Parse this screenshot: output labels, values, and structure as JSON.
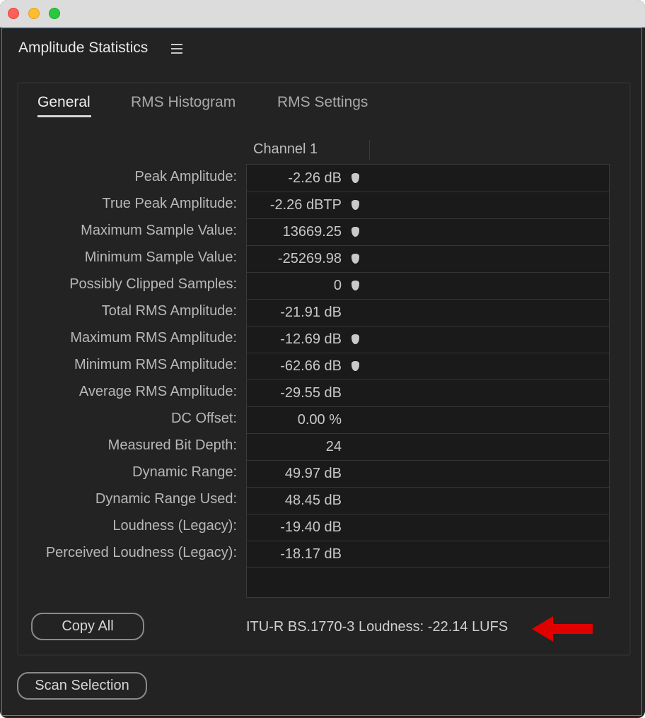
{
  "window": {
    "panel_title": "Amplitude Statistics"
  },
  "tabs": [
    {
      "label": "General",
      "active": true
    },
    {
      "label": "RMS Histogram",
      "active": false
    },
    {
      "label": "RMS Settings",
      "active": false
    }
  ],
  "table": {
    "column_header": "Channel 1",
    "rows": [
      {
        "label": "Peak Amplitude:",
        "value": "-2.26 dB",
        "marker": true
      },
      {
        "label": "True Peak Amplitude:",
        "value": "-2.26 dBTP",
        "marker": true
      },
      {
        "label": "Maximum Sample Value:",
        "value": "13669.25",
        "marker": true
      },
      {
        "label": "Minimum Sample Value:",
        "value": "-25269.98",
        "marker": true
      },
      {
        "label": "Possibly Clipped Samples:",
        "value": "0",
        "marker": true
      },
      {
        "label": "Total RMS Amplitude:",
        "value": "-21.91 dB",
        "marker": false
      },
      {
        "label": "Maximum RMS Amplitude:",
        "value": "-12.69 dB",
        "marker": true
      },
      {
        "label": "Minimum RMS Amplitude:",
        "value": "-62.66 dB",
        "marker": true
      },
      {
        "label": "Average RMS Amplitude:",
        "value": "-29.55 dB",
        "marker": false
      },
      {
        "label": "DC Offset:",
        "value": "0.00 %",
        "marker": false
      },
      {
        "label": "Measured Bit Depth:",
        "value": "24",
        "marker": false
      },
      {
        "label": "Dynamic Range:",
        "value": "49.97 dB",
        "marker": false
      },
      {
        "label": "Dynamic Range Used:",
        "value": "48.45 dB",
        "marker": false
      },
      {
        "label": "Loudness (Legacy):",
        "value": "-19.40 dB",
        "marker": false
      },
      {
        "label": "Perceived Loudness (Legacy):",
        "value": "-18.17 dB",
        "marker": false
      }
    ]
  },
  "footer": {
    "copy_all_label": "Copy All",
    "loudness_text": "ITU-R BS.1770-3 Loudness: -22.14 LUFS",
    "scan_selection_label": "Scan Selection"
  },
  "colors": {
    "annotation_arrow": "#e00000",
    "focus_border": "#2d8ceb"
  },
  "icons": [
    "hamburger-menu-icon",
    "go-to-marker-icon"
  ]
}
